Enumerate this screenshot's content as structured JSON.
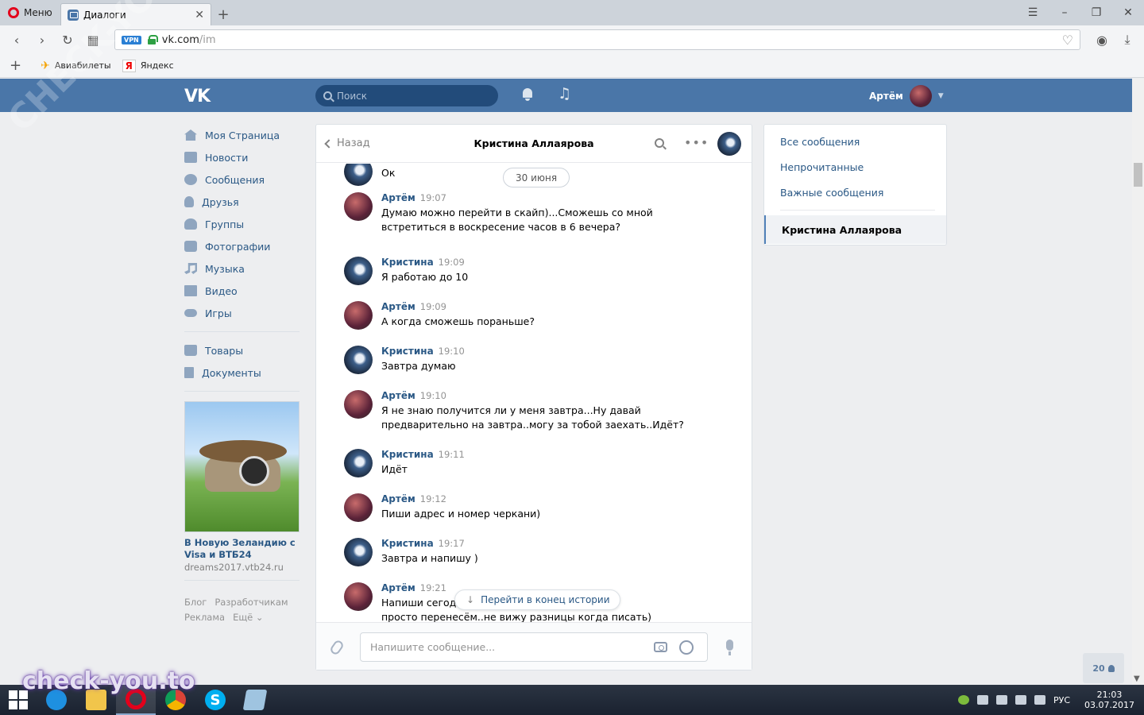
{
  "browser": {
    "menu_label": "Меню",
    "tab_title": "Диалоги",
    "url_host": "vk.com",
    "url_path": "/im",
    "vpn_label": "VPN",
    "bookmarks": [
      "Авиабилеты",
      "Яндекс"
    ],
    "yandex_glyph": "Я"
  },
  "vk": {
    "logo": "VK",
    "search_placeholder": "Поиск",
    "user_name": "Артём",
    "menu": [
      {
        "label": "Моя Страница",
        "icon": "home-icon"
      },
      {
        "label": "Новости",
        "icon": "news-icon"
      },
      {
        "label": "Сообщения",
        "icon": "messages-icon"
      },
      {
        "label": "Друзья",
        "icon": "friends-icon"
      },
      {
        "label": "Группы",
        "icon": "groups-icon"
      },
      {
        "label": "Фотографии",
        "icon": "photos-icon"
      },
      {
        "label": "Музыка",
        "icon": "music-icon"
      },
      {
        "label": "Видео",
        "icon": "video-icon"
      },
      {
        "label": "Игры",
        "icon": "games-icon"
      }
    ],
    "menu2": [
      {
        "label": "Товары",
        "icon": "market-icon"
      },
      {
        "label": "Документы",
        "icon": "docs-icon"
      }
    ],
    "ad": {
      "title": "В Новую Зеландию с Visa и ВТБ24",
      "domain": "dreams2017.vtb24.ru"
    },
    "footer": {
      "blog": "Блог",
      "dev": "Разработчикам",
      "ads": "Реклама",
      "more": "Ещё ⌄"
    }
  },
  "chat": {
    "back_label": "Назад",
    "title": "Кристина Аллаярова",
    "partial_text": "Ок",
    "date_pill": "30 июня",
    "messages": [
      {
        "author": "Артём",
        "time": "19:07",
        "text": "Думаю можно перейти в скайп)...Сможешь со мной\nвстретиться в воскресение часов в 6 вечера?"
      },
      {
        "author": "Кристина",
        "time": "19:09",
        "text": "Я работаю до 10"
      },
      {
        "author": "Артём",
        "time": "19:09",
        "text": "А когда сможешь пораньше?"
      },
      {
        "author": "Кристина",
        "time": "19:10",
        "text": "Завтра думаю"
      },
      {
        "author": "Артём",
        "time": "19:10",
        "text": "Я не знаю получится ли у меня завтра...Ну давай\nпредварительно на завтра..могу за тобой заехать..Идёт?"
      },
      {
        "author": "Кристина",
        "time": "19:11",
        "text": "Идёт"
      },
      {
        "author": "Артём",
        "time": "19:12",
        "text": "Пиши адрес и номер черкани)"
      },
      {
        "author": "Кристина",
        "time": "19:17",
        "text": "Завтра и напишу )"
      },
      {
        "author": "Артём",
        "time": "19:21",
        "text": "Напиши сегодн                                                   е получится,\nпросто перенесём..не вижу разницы когда писать)"
      }
    ],
    "jump_label": "Перейти в конец истории",
    "input_placeholder": "Напишите сообщение..."
  },
  "filters": {
    "all": "Все сообщения",
    "unread": "Непрочитанные",
    "important": "Важные сообщения",
    "active_dialog": "Кристина Аллаярова"
  },
  "online_count": "20",
  "taskbar": {
    "lang": "РУС",
    "time": "21:03",
    "date": "03.07.2017",
    "skype_glyph": "S"
  },
  "watermarks": {
    "diagonal": "CHECK-YOU.ME",
    "corner": "check-you.to"
  },
  "colors": {
    "vk_blue": "#4a76a8",
    "link": "#2a5885",
    "page_bg": "#edeef0"
  }
}
